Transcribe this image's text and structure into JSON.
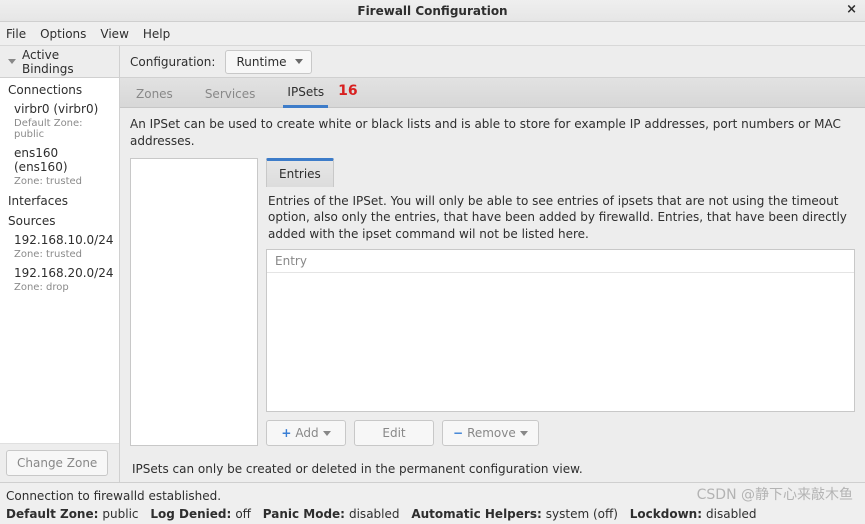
{
  "window": {
    "title": "Firewall Configuration"
  },
  "menu": {
    "file": "File",
    "options": "Options",
    "view": "View",
    "help": "Help"
  },
  "sidebar_header": "Active Bindings",
  "config": {
    "label": "Configuration:",
    "value": "Runtime"
  },
  "sidebar": {
    "connections_label": "Connections",
    "conn": [
      {
        "name": "virbr0 (virbr0)",
        "zone": "Default Zone: public"
      },
      {
        "name": "ens160 (ens160)",
        "zone": "Zone: trusted"
      }
    ],
    "interfaces_label": "Interfaces",
    "sources_label": "Sources",
    "sources": [
      {
        "name": "192.168.10.0/24",
        "zone": "Zone: trusted"
      },
      {
        "name": "192.168.20.0/24",
        "zone": "Zone: drop"
      }
    ],
    "change_zone": "Change Zone"
  },
  "tabs": {
    "zones": "Zones",
    "services": "Services",
    "ipsets": "IPSets",
    "annot": "16"
  },
  "ipset": {
    "desc": "An IPSet can be used to create white or black lists and is able to store for example IP addresses, port numbers or MAC addresses.",
    "entries_tab": "Entries",
    "entries_desc": "Entries of the IPSet. You will only be able to see entries of ipsets that are not using the timeout option, also only the entries, that have been added by firewalld. Entries, that have been directly added with the ipset command wil not be listed here.",
    "entry_col": "Entry",
    "add": "Add",
    "edit": "Edit",
    "remove": "Remove",
    "footer": "IPSets can only be created or deleted in the permanent configuration view."
  },
  "status": {
    "line1": "Connection to firewalld established.",
    "default_zone_l": "Default Zone:",
    "default_zone_v": "public",
    "log_denied_l": "Log Denied:",
    "log_denied_v": "off",
    "panic_l": "Panic Mode:",
    "panic_v": "disabled",
    "helpers_l": "Automatic Helpers:",
    "helpers_v": "system (off)",
    "lockdown_l": "Lockdown:",
    "lockdown_v": "disabled"
  },
  "watermark": "CSDN @静下心来敲木鱼"
}
